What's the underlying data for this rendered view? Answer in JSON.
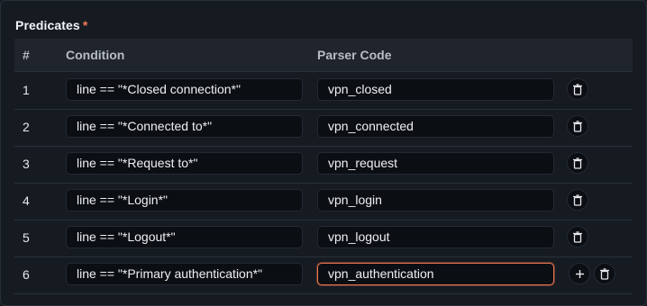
{
  "section": {
    "title": "Predicates",
    "required_marker": "*"
  },
  "columns": {
    "index": "#",
    "condition": "Condition",
    "parser_code": "Parser Code"
  },
  "rows": [
    {
      "index": "1",
      "condition": "line == \"*Closed connection*\"",
      "parser_code": "vpn_closed"
    },
    {
      "index": "2",
      "condition": "line == \"*Connected to*\"",
      "parser_code": "vpn_connected"
    },
    {
      "index": "3",
      "condition": "line == \"*Request to*\"",
      "parser_code": "vpn_request"
    },
    {
      "index": "4",
      "condition": "line == \"*Login*\"",
      "parser_code": "vpn_login"
    },
    {
      "index": "5",
      "condition": "line == \"*Logout*\"",
      "parser_code": "vpn_logout"
    },
    {
      "index": "6",
      "condition": "line == \"*Primary authentication*\"",
      "parser_code": "vpn_authentication"
    }
  ],
  "focused_field": "rows.5.parser_code",
  "icons": {
    "delete": "trash-icon",
    "add": "plus-icon"
  },
  "colors": {
    "accent_focus": "#e8744c",
    "required": "#f07a56",
    "background": "#161b22"
  }
}
